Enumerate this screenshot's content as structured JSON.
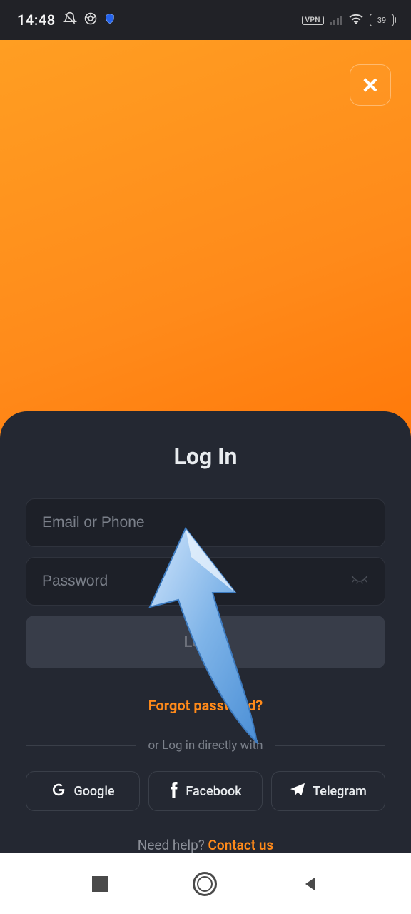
{
  "statusbar": {
    "time": "14:48",
    "vpn": "VPN",
    "battery": "39"
  },
  "login": {
    "title": "Log In",
    "email_placeholder": "Email or Phone",
    "password_placeholder": "Password",
    "submit_label": "Log In",
    "forgot_label": "Forgot password?",
    "divider_label": "or Log in directly with",
    "social": {
      "google": "Google",
      "facebook": "Facebook",
      "telegram": "Telegram"
    },
    "help_label": "Need help? ",
    "contact_label": "Contact us"
  },
  "colors": {
    "accent": "#ff8a1a",
    "sheet_bg": "#242832",
    "field_bg": "#1d2028"
  }
}
